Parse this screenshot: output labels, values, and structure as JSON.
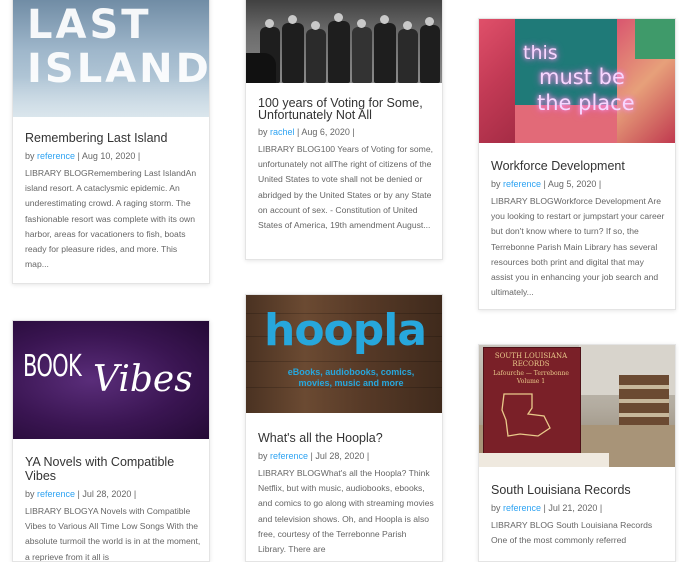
{
  "cards": [
    {
      "image_text": [
        "LAST",
        "ISLAND"
      ],
      "title": "Remembering Last Island",
      "meta_by": "by ",
      "author": "reference",
      "meta_rest": " | Aug 10, 2020 |",
      "excerpt": "LIBRARY BLOGRemembering Last IslandAn island resort. A cataclysmic epidemic. An underestimating crowd. A raging storm. The fashionable resort was complete with its own harbor, areas for vacationers to fish, boats ready for pleasure rides, and more. This map..."
    },
    {
      "title": "100 years of Voting for Some, Unfortunately Not All",
      "meta_by": "by ",
      "author": "rachel",
      "meta_rest": " | Aug 6, 2020 |",
      "excerpt": "LIBRARY BLOG100 Years of Voting for some, unfortunately not allThe right of citizens of the United States to vote shall not be denied or abridged by the United States or by any State on account of sex. - Constitution of United States of America, 19th amendment August..."
    },
    {
      "image_text": [
        "this",
        "must be",
        "the place"
      ],
      "title": "Workforce Development",
      "meta_by": "by ",
      "author": "reference",
      "meta_rest": " | Aug 5, 2020 |",
      "excerpt": "LIBRARY BLOGWorkforce Development Are you looking to restart or jumpstart your career but don't know where to turn? If so, the Terrebonne Parish Main Library has several resources both print and digital that may assist you in enhancing your job search and ultimately..."
    },
    {
      "image_text": [
        "BOOK",
        "Vibes"
      ],
      "title": "YA Novels with Compatible Vibes",
      "meta_by": "by ",
      "author": "reference",
      "meta_rest": " | Jul 28, 2020 |",
      "excerpt": "LIBRARY BLOGYA Novels with Compatible Vibes to Various All Time Low Songs With the absolute turmoil the world is in at the moment, a reprieve from it all is"
    },
    {
      "image_text": [
        "hoopla",
        "eBooks, audiobooks, comics, movies, music and more"
      ],
      "title": "What's all the Hoopla?",
      "meta_by": "by ",
      "author": "reference",
      "meta_rest": " | Jul 28, 2020 |",
      "excerpt": "LIBRARY BLOGWhat's all the Hoopla? Think Netflix, but with music, audiobooks, ebooks, and comics to go along with streaming movies and television shows. Oh, and Hoopla is also free, courtesy of the Terrebonne Parish Library. There are"
    },
    {
      "image_text": [
        "SOUTH LOUISIANA RECORDS",
        "Lafourche — Terrebonne",
        "Volume 1"
      ],
      "title": "South Louisiana Records",
      "meta_by": "by ",
      "author": "reference",
      "meta_rest": " | Jul 21, 2020 |",
      "excerpt": "LIBRARY BLOG South Louisiana Records One of the most commonly referred"
    }
  ],
  "colors": {
    "link": "#2ea3f2",
    "title": "#333333",
    "text": "#666666",
    "hoopla_blue": "#27a7dc"
  }
}
